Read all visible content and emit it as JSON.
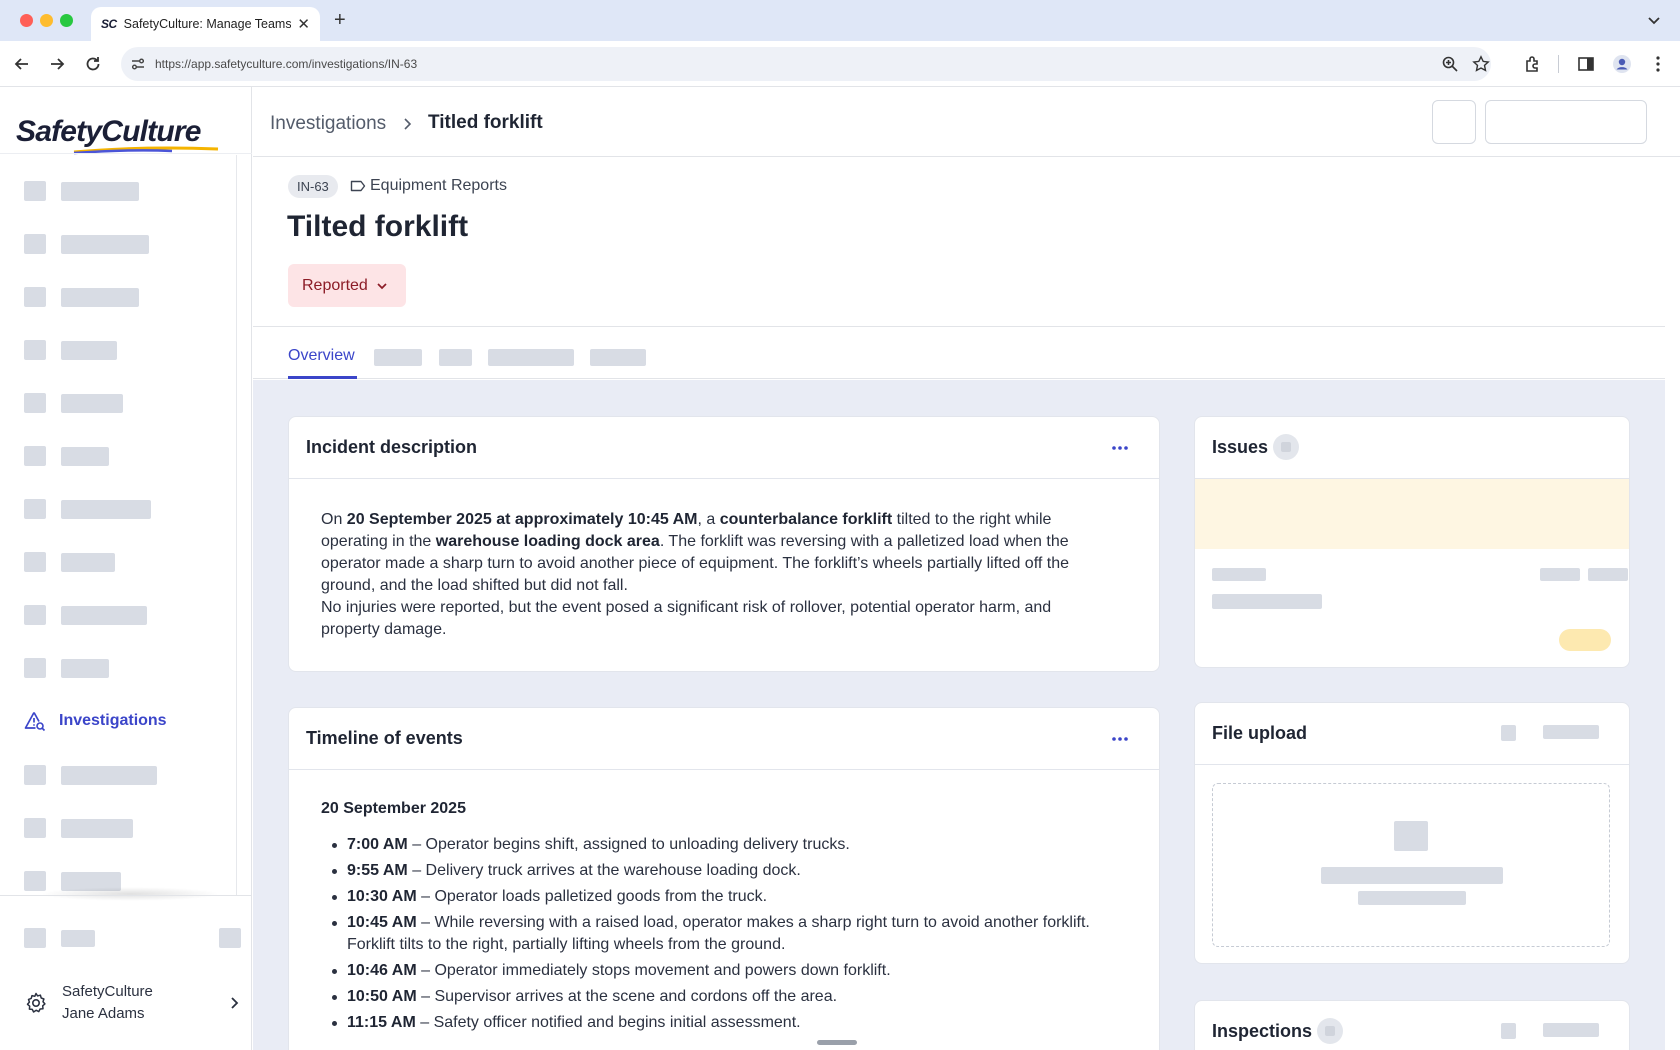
{
  "browser": {
    "tab_title": "SafetyCulture: Manage Teams and...",
    "tab_favicon": "SC",
    "url": "https://app.safetyculture.com/investigations/IN-63"
  },
  "sidebar": {
    "logo_text": "SafetyCulture",
    "active_item": "Investigations",
    "org_name": "SafetyCulture",
    "user_name": "Jane Adams"
  },
  "header": {
    "breadcrumb_root": "Investigations",
    "breadcrumb_current": "Titled forklift"
  },
  "record": {
    "id": "IN-63",
    "category": "Equipment Reports",
    "title": "Tilted forklift",
    "status": "Reported",
    "status_color": "#8c1c27"
  },
  "tabs": {
    "active": "Overview"
  },
  "incident": {
    "title": "Incident description",
    "p1_a": "On ",
    "p1_b": "20 September 2025 at approximately 10:45 AM",
    "p1_c": ", a ",
    "p1_d": "counterbalance forklift",
    "p1_e": " tilted to the right while operating in the ",
    "p1_f": "warehouse loading dock area",
    "p1_g": ". The forklift was reversing with a palletized load when the operator made a sharp turn to avoid another piece of equipment. The forklift’s wheels partially lifted off the ground, and the load shifted but did not fall.",
    "p2": "No injuries were reported, but the event posed a significant risk of rollover, potential operator harm, and property damage."
  },
  "timeline": {
    "title": "Timeline of events",
    "date": "20 September 2025",
    "events": [
      {
        "time": "7:00 AM",
        "text": " – Operator begins shift, assigned to unloading delivery trucks."
      },
      {
        "time": "9:55 AM",
        "text": " – Delivery truck arrives at the warehouse loading dock."
      },
      {
        "time": "10:30 AM",
        "text": " – Operator loads palletized goods from the truck."
      },
      {
        "time": "10:45 AM",
        "text": " – While reversing with a raised load, operator makes a sharp right turn to avoid another forklift. Forklift tilts to the right, partially lifting wheels from the ground."
      },
      {
        "time": "10:46 AM",
        "text": " – Operator immediately stops movement and powers down forklift."
      },
      {
        "time": "10:50 AM",
        "text": " – Supervisor arrives at the scene and cordons off the area."
      },
      {
        "time": "11:15 AM",
        "text": " – Safety officer notified and begins initial assessment."
      }
    ]
  },
  "issues": {
    "title": "Issues"
  },
  "file_upload": {
    "title": "File upload"
  },
  "inspections": {
    "title": "Inspections"
  },
  "colors": {
    "accent": "#3b45c9",
    "status_bg": "#fde4e6",
    "content_bg": "#e9ecf5"
  }
}
